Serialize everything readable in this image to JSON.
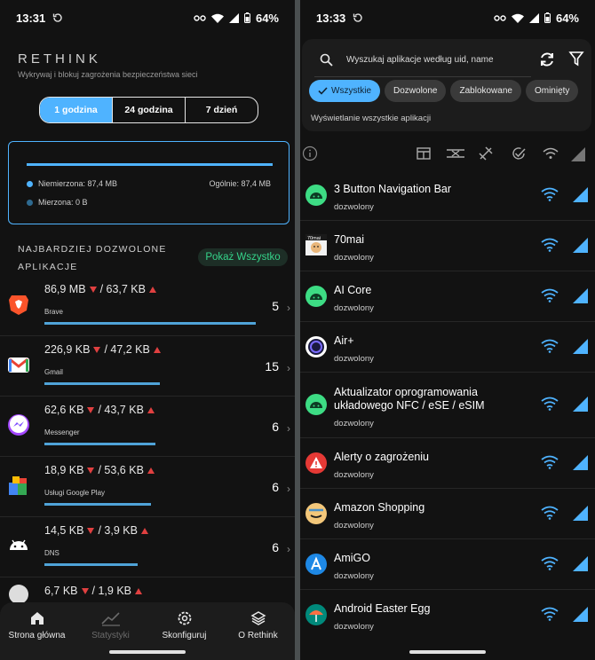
{
  "left": {
    "status": {
      "time": "13:31",
      "battery": "64%"
    },
    "brand": {
      "title": "RETHINK",
      "subtitle": "Wykrywaj i blokuj zagrożenia bezpieczeństwa sieci"
    },
    "time_toggle": [
      "1 godzina",
      "24 godzina",
      "7 dzień"
    ],
    "usage": {
      "unmetered": "Niemierzona: 87,4 MB",
      "metered": "Mierzona: 0 B",
      "total": "Ogólnie: 87,4 MB",
      "unmetered_color": "#4fb3ff",
      "metered_color": "#2e6a90"
    },
    "section": {
      "title_line1": "NAJBARDZIEJ DOZWOLONE",
      "title_line2": "APLIKACJE",
      "show_all": "Pokaż Wszystko"
    },
    "apps": [
      {
        "download": "86,9 MB",
        "upload": "/ 63,7 KB",
        "name": "Brave",
        "count": "5",
        "bar_fraction": 0.95,
        "icon": "brave-icon"
      },
      {
        "download": "226,9 KB",
        "upload": "/ 47,2 KB",
        "name": "Gmail",
        "count": "15",
        "bar_fraction": 0.52,
        "icon": "gmail-icon"
      },
      {
        "download": "62,6 KB",
        "upload": "/ 43,7 KB",
        "name": "Messenger",
        "count": "6",
        "bar_fraction": 0.5,
        "icon": "messenger-icon"
      },
      {
        "download": "18,9 KB",
        "upload": "/ 53,6 KB",
        "name": "Usługi Google Play",
        "count": "6",
        "bar_fraction": 0.48,
        "icon": "google-play-services-icon"
      },
      {
        "download": "14,5 KB",
        "upload": "/ 3,9 KB",
        "name": "DNS",
        "count": "6",
        "bar_fraction": 0.42,
        "icon": "android-icon"
      },
      {
        "download": "6,7 KB",
        "upload": "/ 1,9 KB",
        "name": "",
        "count": "",
        "bar_fraction": 0,
        "icon": "app-icon"
      }
    ],
    "nav": [
      {
        "label": "Strona główna",
        "icon": "home-icon",
        "dim": false
      },
      {
        "label": "Statystyki",
        "icon": "stats-icon",
        "dim": true
      },
      {
        "label": "Skonfiguruj",
        "icon": "settings-icon",
        "dim": false
      },
      {
        "label": "O Rethink",
        "icon": "layers-icon",
        "dim": false
      }
    ]
  },
  "right": {
    "status": {
      "time": "13:33",
      "battery": "64%"
    },
    "search_placeholder": "Wyszukaj aplikacje według uid, name",
    "chips": [
      "Wszystkie",
      "Dozwolone",
      "Zablokowane",
      "Ominięty"
    ],
    "caption": "Wyświetlanie wszystkie aplikacji",
    "apps": [
      {
        "name": "3 Button Navigation Bar",
        "status": "dozwolony",
        "icon": "android-icon"
      },
      {
        "name": "70mai",
        "status": "dozwolony",
        "icon": "70mai-icon"
      },
      {
        "name": "AI Core",
        "status": "dozwolony",
        "icon": "android-icon"
      },
      {
        "name": "Air+",
        "status": "dozwolony",
        "icon": "air-plus-icon"
      },
      {
        "name": "Aktualizator oprogramowania układowego NFC / eSE / eSIM",
        "status": "dozwolony",
        "icon": "android-icon"
      },
      {
        "name": "Alerty o zagrożeniu",
        "status": "dozwolony",
        "icon": "alert-icon"
      },
      {
        "name": "Amazon Shopping",
        "status": "dozwolony",
        "icon": "amazon-icon"
      },
      {
        "name": "AmiGO",
        "status": "dozwolony",
        "icon": "amigo-icon"
      },
      {
        "name": "Android Easter Egg",
        "status": "dozwolony",
        "icon": "easter-egg-icon"
      }
    ]
  }
}
